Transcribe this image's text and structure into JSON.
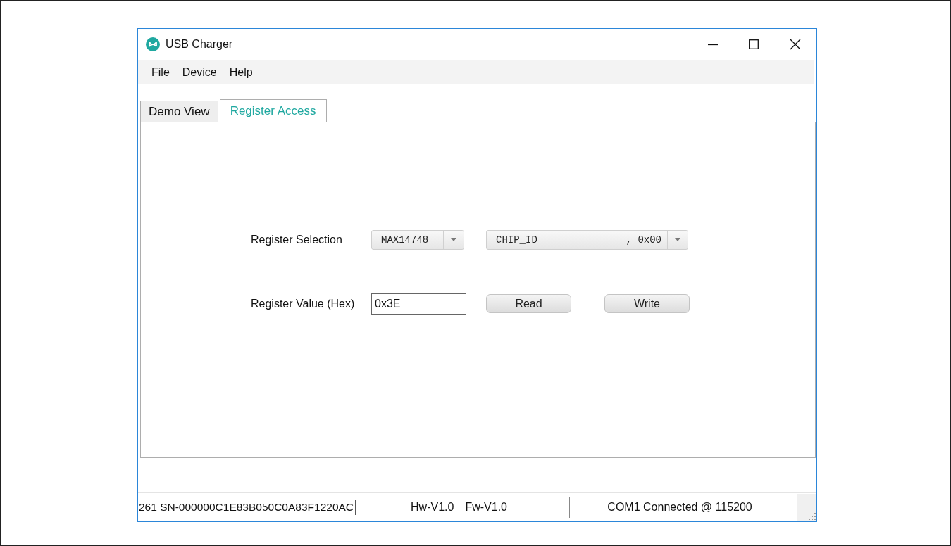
{
  "window": {
    "title": "USB Charger"
  },
  "menu": [
    "File",
    "Device",
    "Help"
  ],
  "tabs": [
    {
      "label": "Demo View",
      "selected": false
    },
    {
      "label": "Register Access",
      "selected": true
    }
  ],
  "register_selection": {
    "label": "Register Selection",
    "device": "MAX14748",
    "register_name": "CHIP_ID",
    "register_address": ", 0x00"
  },
  "register_value": {
    "label": "Register Value (Hex)",
    "value": "0x3E"
  },
  "buttons": [
    "Read",
    "Write"
  ],
  "status_bar": {
    "serial": "261 SN-000000C1E83B050C0A83F1220AC",
    "hardware": "Hw-V1.0",
    "firmware": "Fw-V1.0",
    "connection": "COM1 Connected @ 115200"
  }
}
